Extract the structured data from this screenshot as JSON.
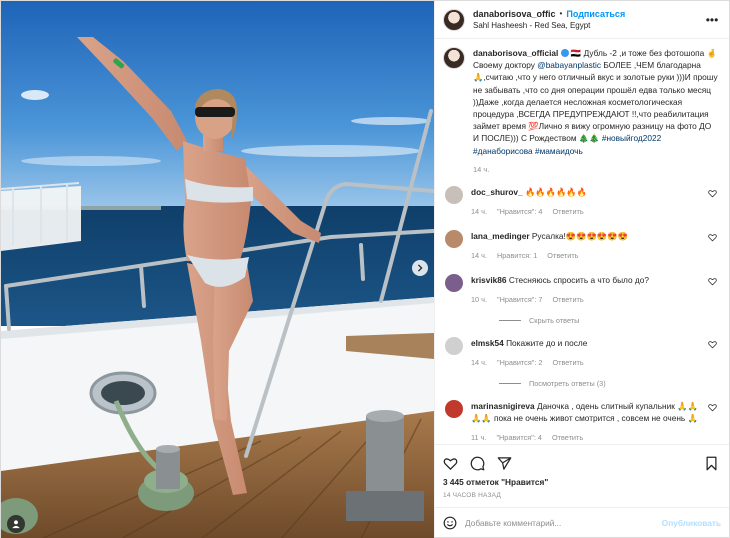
{
  "header": {
    "username": "danaborisova_offic",
    "separator": "•",
    "follow_label": "Подписаться",
    "location": "Sahl Hasheesh - Red Sea, Egypt",
    "more_icon": "more-horizontal-icon"
  },
  "caption": {
    "username": "danaborisova_official",
    "text_1": " 🇪🇬 Дубль -2 ,и тоже без фотошопа 🤞 Своему доктору ",
    "mention": "@babayanplastic",
    "text_2": " БОЛЕЕ ,ЧЕМ благодарна 🙏,считаю ,что у него отличный вкус и золотые руки )))И прошу не забывать ,что со дня операции прошёл едва только месяц ))Даже ,когда делается несложная косметологическая процедура ,ВСЕГДА ПРЕДУПРЕЖДАЮТ !!,что реабилитация займет время 💯Лично я вижу огромную разницу на фото ДО И ПОСЛЕ))) С Рождеством 🎄🎄 ",
    "hashtags": "#новыйгод2022 #данаборисова #мамаидочь",
    "time": "14 ч."
  },
  "comments": [
    {
      "username": "doc_shurov_",
      "text": "🔥🔥🔥🔥🔥🔥",
      "time": "14 ч.",
      "likes": "\"Нравится\": 4",
      "reply": "Ответить",
      "avatar_color": "#c8c0b8"
    },
    {
      "username": "lana_medinger",
      "text": "Русалка!😍😍😍😍😍😍",
      "time": "14 ч.",
      "likes": "Нравится: 1",
      "reply": "Ответить",
      "avatar_color": "#b88a6a"
    },
    {
      "username": "krisvik86",
      "text": "Стесняюсь спросить а что было до?",
      "time": "10 ч.",
      "likes": "\"Нравится\": 7",
      "reply": "Ответить",
      "avatar_color": "#7a5e8c",
      "toggle": "Скрыть ответы"
    },
    {
      "username": "elmsk54",
      "text": "Покажите до и после",
      "time": "14 ч.",
      "likes": "\"Нравится\": 2",
      "reply": "Ответить",
      "avatar_color": "#d0d0d0",
      "toggle": "Посмотреть ответы (3)"
    },
    {
      "username": "marinasnigireva",
      "text": "Даночка , одень слитный купальник 🙏🙏🙏🙏 пока не очень живот смотрится , совсем не очень 🙏",
      "time": "11 ч.",
      "likes": "\"Нравится\": 4",
      "reply": "Ответить",
      "avatar_color": "#c0392b"
    }
  ],
  "actions": {
    "like_icon": "heart-icon",
    "comment_icon": "comment-icon",
    "share_icon": "share-icon",
    "save_icon": "bookmark-icon",
    "likes": "3 445 отметок \"Нравится\"",
    "ago": "14 ЧАСОВ НАЗАД"
  },
  "add_comment": {
    "emoji_icon": "emoji-icon",
    "placeholder": "Добавьте комментарий...",
    "publish_label": "Опубликовать"
  },
  "colors": {
    "accent": "#0095f6",
    "link": "#00376b",
    "muted": "#8e8e8e",
    "sky": "#2f7fd0",
    "sea": "#14456b"
  }
}
